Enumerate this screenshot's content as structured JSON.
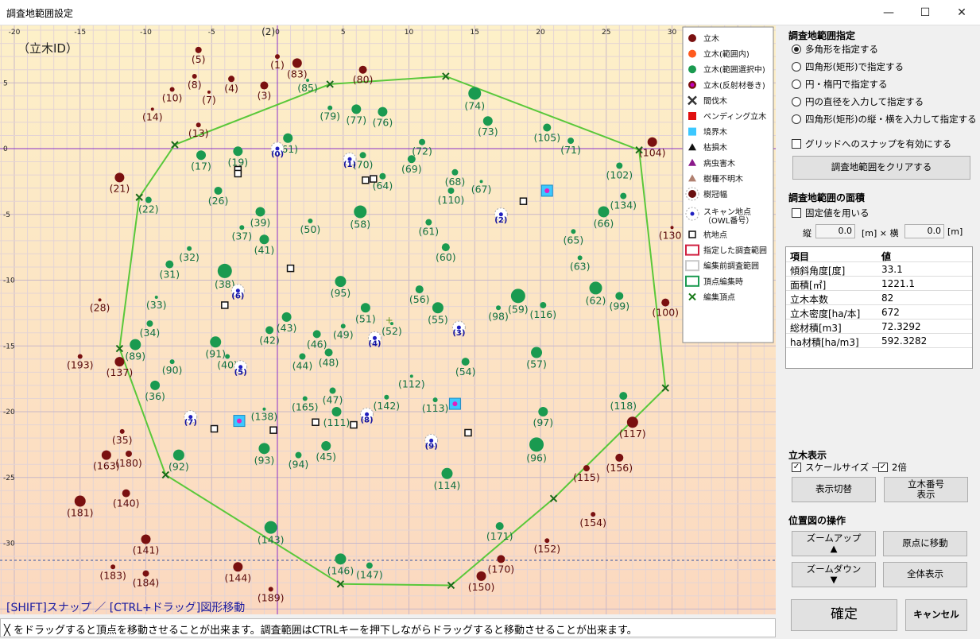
{
  "window": {
    "title": "調査地範囲設定",
    "minimize_icon": "minimize-icon",
    "maximize_icon": "maximize-icon",
    "close_icon": "close-icon"
  },
  "plot": {
    "mode_label": "（立木ID）",
    "hint": "[SHIFT]スナップ ／ [CTRL+ドラッグ]図形移動",
    "x_ticks": [
      -20,
      -15,
      -10,
      -5,
      0,
      5,
      10,
      15,
      20,
      25,
      30
    ],
    "y_ticks": [
      5,
      0,
      -5,
      -10,
      -15,
      -20,
      -25,
      -30
    ],
    "top_marker": "(2)",
    "trees": [
      {
        "id": "(5)",
        "x": -6,
        "y": 7.5,
        "r": 4,
        "c": "#7a1010"
      },
      {
        "id": "(1)",
        "x": 0,
        "y": 7,
        "r": 3,
        "c": "#7a1010"
      },
      {
        "id": "(83)",
        "x": 1.5,
        "y": 6.5,
        "r": 6,
        "c": "#7a1010"
      },
      {
        "id": "(80)",
        "x": 6.5,
        "y": 6,
        "r": 5,
        "c": "#7a1010"
      },
      {
        "id": "(8)",
        "x": -6.3,
        "y": 5.5,
        "r": 3,
        "c": "#7a1010"
      },
      {
        "id": "(4)",
        "x": -3.5,
        "y": 5.3,
        "r": 4,
        "c": "#7a1010"
      },
      {
        "id": "(3)",
        "x": -1,
        "y": 4.8,
        "r": 5,
        "c": "#7a1010"
      },
      {
        "id": "(10)",
        "x": -8,
        "y": 4.5,
        "r": 3,
        "c": "#7a1010"
      },
      {
        "id": "(7)",
        "x": -5.2,
        "y": 4.3,
        "r": 2,
        "c": "#7a1010"
      },
      {
        "id": "(85)",
        "x": 2.3,
        "y": 5.2,
        "r": 2,
        "c": "#1a9a50"
      },
      {
        "id": "(14)",
        "x": -9.5,
        "y": 3,
        "r": 2,
        "c": "#7a1010"
      },
      {
        "id": "(13)",
        "x": -6,
        "y": 1.8,
        "r": 3,
        "c": "#7a1010"
      },
      {
        "id": "(104)",
        "x": 28.5,
        "y": 0.5,
        "r": 6,
        "c": "#7a1010"
      },
      {
        "id": "(21)",
        "x": -12,
        "y": -2.2,
        "r": 6,
        "c": "#7a1010"
      },
      {
        "id": "(130)",
        "x": 30,
        "y": -6,
        "r": 2,
        "c": "#7a1010"
      },
      {
        "id": "(28)",
        "x": -13.5,
        "y": -11.5,
        "r": 2,
        "c": "#7a1010"
      },
      {
        "id": "(100)",
        "x": 29.5,
        "y": -11.7,
        "r": 5,
        "c": "#7a1010"
      },
      {
        "id": "(193)",
        "x": -15,
        "y": -15.8,
        "r": 3,
        "c": "#7a1010"
      },
      {
        "id": "(137)",
        "x": -12,
        "y": -16.2,
        "r": 6,
        "c": "#7a1010"
      },
      {
        "id": "(117)",
        "x": 27,
        "y": -20.8,
        "r": 7,
        "c": "#7a1010"
      },
      {
        "id": "(35)",
        "x": -11.8,
        "y": -21.5,
        "r": 3,
        "c": "#7a1010"
      },
      {
        "id": "(163)",
        "x": -13,
        "y": -23.3,
        "r": 6,
        "c": "#7a1010"
      },
      {
        "id": "(180)",
        "x": -11.3,
        "y": -23.2,
        "r": 4,
        "c": "#7a1010"
      },
      {
        "id": "(156)",
        "x": 26,
        "y": -23.5,
        "r": 5,
        "c": "#7a1010"
      },
      {
        "id": "(115)",
        "x": 23.5,
        "y": -24.3,
        "r": 4,
        "c": "#7a1010"
      },
      {
        "id": "(140)",
        "x": -11.5,
        "y": -26.2,
        "r": 5,
        "c": "#7a1010"
      },
      {
        "id": "(181)",
        "x": -15,
        "y": -26.8,
        "r": 7,
        "c": "#7a1010"
      },
      {
        "id": "(154)",
        "x": 24,
        "y": -27.8,
        "r": 3,
        "c": "#7a1010"
      },
      {
        "id": "(141)",
        "x": -10,
        "y": -29.7,
        "r": 6,
        "c": "#7a1010"
      },
      {
        "id": "(152)",
        "x": 20.5,
        "y": -29.8,
        "r": 3,
        "c": "#7a1010"
      },
      {
        "id": "(183)",
        "x": -12.5,
        "y": -31.8,
        "r": 3,
        "c": "#7a1010"
      },
      {
        "id": "(184)",
        "x": -10,
        "y": -32.3,
        "r": 4,
        "c": "#7a1010"
      },
      {
        "id": "(144)",
        "x": -3,
        "y": -31.8,
        "r": 6,
        "c": "#7a1010"
      },
      {
        "id": "(170)",
        "x": 17,
        "y": -31.2,
        "r": 5,
        "c": "#7a1010"
      },
      {
        "id": "(150)",
        "x": 15.5,
        "y": -32.5,
        "r": 6,
        "c": "#7a1010"
      },
      {
        "id": "(189)",
        "x": -0.5,
        "y": -33.5,
        "r": 3,
        "c": "#7a1010"
      },
      {
        "id": "(74)",
        "x": 15,
        "y": 4.2,
        "r": 8,
        "c": "#1a9a50"
      },
      {
        "id": "(79)",
        "x": 4,
        "y": 3.1,
        "r": 3,
        "c": "#1a9a50"
      },
      {
        "id": "(77)",
        "x": 6,
        "y": 3,
        "r": 6,
        "c": "#1a9a50"
      },
      {
        "id": "(76)",
        "x": 8,
        "y": 2.8,
        "r": 6,
        "c": "#1a9a50"
      },
      {
        "id": "(73)",
        "x": 16,
        "y": 2.1,
        "r": 6,
        "c": "#1a9a50"
      },
      {
        "id": "(105)",
        "x": 20.5,
        "y": 1.6,
        "r": 5,
        "c": "#1a9a50"
      },
      {
        "id": "(71)",
        "x": 22.3,
        "y": 0.6,
        "r": 4,
        "c": "#1a9a50"
      },
      {
        "id": "(61)",
        "x": 0.8,
        "y": 0.8,
        "r": 6,
        "c": "#1a9a50"
      },
      {
        "id": "(72)",
        "x": 11,
        "y": 0.5,
        "r": 4,
        "c": "#1a9a50"
      },
      {
        "id": "(19)",
        "x": -3,
        "y": -0.2,
        "r": 6,
        "c": "#1a9a50"
      },
      {
        "id": "(17)",
        "x": -5.8,
        "y": -0.5,
        "r": 6,
        "c": "#1a9a50"
      },
      {
        "id": "(70)",
        "x": 6.5,
        "y": -0.5,
        "r": 4,
        "c": "#1a9a50"
      },
      {
        "id": "(69)",
        "x": 10.2,
        "y": -0.8,
        "r": 5,
        "c": "#1a9a50"
      },
      {
        "id": "(102)",
        "x": 26,
        "y": -1.3,
        "r": 4,
        "c": "#1a9a50"
      },
      {
        "id": "(64)",
        "x": 8,
        "y": -2.1,
        "r": 4,
        "c": "#1a9a50"
      },
      {
        "id": "(68)",
        "x": 13.5,
        "y": -1.8,
        "r": 4,
        "c": "#1a9a50"
      },
      {
        "id": "(67)",
        "x": 15.5,
        "y": -2.5,
        "r": 2,
        "c": "#1a9a50"
      },
      {
        "id": "(110)",
        "x": 13.2,
        "y": -3.2,
        "r": 4,
        "c": "#1a9a50"
      },
      {
        "id": "(26)",
        "x": -4.5,
        "y": -3.2,
        "r": 5,
        "c": "#1a9a50"
      },
      {
        "id": "(22)",
        "x": -9.8,
        "y": -3.9,
        "r": 4,
        "c": "#1a9a50"
      },
      {
        "id": "(134)",
        "x": 26.3,
        "y": -3.6,
        "r": 4,
        "c": "#1a9a50"
      },
      {
        "id": "(39)",
        "x": -1.3,
        "y": -4.8,
        "r": 6,
        "c": "#1a9a50"
      },
      {
        "id": "(58)",
        "x": 6.3,
        "y": -4.8,
        "r": 8,
        "c": "#1a9a50"
      },
      {
        "id": "(66)",
        "x": 24.8,
        "y": -4.8,
        "r": 7,
        "c": "#1a9a50"
      },
      {
        "id": "(50)",
        "x": 2.5,
        "y": -5.5,
        "r": 3,
        "c": "#1a9a50"
      },
      {
        "id": "(61)",
        "x": 11.5,
        "y": -5.6,
        "r": 4,
        "c": "#1a9a50"
      },
      {
        "id": "(37)",
        "x": -2.7,
        "y": -6,
        "r": 3,
        "c": "#1a9a50"
      },
      {
        "id": "(65)",
        "x": 22.5,
        "y": -6.3,
        "r": 3,
        "c": "#1a9a50"
      },
      {
        "id": "(41)",
        "x": -1,
        "y": -6.9,
        "r": 6,
        "c": "#1a9a50"
      },
      {
        "id": "(60)",
        "x": 12.8,
        "y": -7.5,
        "r": 5,
        "c": "#1a9a50"
      },
      {
        "id": "(32)",
        "x": -6.7,
        "y": -7.6,
        "r": 3,
        "c": "#1a9a50"
      },
      {
        "id": "(63)",
        "x": 23,
        "y": -8.3,
        "r": 3,
        "c": "#1a9a50"
      },
      {
        "id": "(31)",
        "x": -8.2,
        "y": -8.8,
        "r": 5,
        "c": "#1a9a50"
      },
      {
        "id": "(38)",
        "x": -4,
        "y": -9.3,
        "r": 9,
        "c": "#1a9a50"
      },
      {
        "id": "(95)",
        "x": 4.8,
        "y": -10.1,
        "r": 7,
        "c": "#1a9a50"
      },
      {
        "id": "(56)",
        "x": 10.8,
        "y": -10.7,
        "r": 5,
        "c": "#1a9a50"
      },
      {
        "id": "(62)",
        "x": 24.2,
        "y": -10.6,
        "r": 8,
        "c": "#1a9a50"
      },
      {
        "id": "(59)",
        "x": 18.3,
        "y": -11.2,
        "r": 9,
        "c": "#1a9a50"
      },
      {
        "id": "(99)",
        "x": 26,
        "y": -11.2,
        "r": 5,
        "c": "#1a9a50"
      },
      {
        "id": "(33)",
        "x": -9.2,
        "y": -11.3,
        "r": 2,
        "c": "#1a9a50"
      },
      {
        "id": "(51)",
        "x": 6.7,
        "y": -12.1,
        "r": 6,
        "c": "#1a9a50"
      },
      {
        "id": "(55)",
        "x": 12.2,
        "y": -12.1,
        "r": 7,
        "c": "#1a9a50"
      },
      {
        "id": "(98)",
        "x": 16.8,
        "y": -12.1,
        "r": 3,
        "c": "#1a9a50"
      },
      {
        "id": "(116)",
        "x": 20.2,
        "y": -11.9,
        "r": 4,
        "c": "#1a9a50"
      },
      {
        "id": "(43)",
        "x": 0.7,
        "y": -12.8,
        "r": 6,
        "c": "#1a9a50"
      },
      {
        "id": "(34)",
        "x": -9.7,
        "y": -13.3,
        "r": 4,
        "c": "#1a9a50"
      },
      {
        "id": "(49)",
        "x": 5,
        "y": -13.5,
        "r": 3,
        "c": "#1a9a50"
      },
      {
        "id": "(52)",
        "x": 8.7,
        "y": -13.3,
        "r": 2,
        "c": "#1a9a50"
      },
      {
        "id": "(42)",
        "x": -0.6,
        "y": -13.8,
        "r": 5,
        "c": "#1a9a50"
      },
      {
        "id": "(46)",
        "x": 3,
        "y": -14.1,
        "r": 5,
        "c": "#1a9a50"
      },
      {
        "id": "(91)",
        "x": -4.7,
        "y": -14.7,
        "r": 7,
        "c": "#1a9a50"
      },
      {
        "id": "(89)",
        "x": -10.8,
        "y": -14.9,
        "r": 7,
        "c": "#1a9a50"
      },
      {
        "id": "(40)",
        "x": -3.8,
        "y": -15.8,
        "r": 3,
        "c": "#1a9a50"
      },
      {
        "id": "(48)",
        "x": 3.9,
        "y": -15.5,
        "r": 5,
        "c": "#1a9a50"
      },
      {
        "id": "(57)",
        "x": 19.7,
        "y": -15.5,
        "r": 7,
        "c": "#1a9a50"
      },
      {
        "id": "(44)",
        "x": 1.9,
        "y": -15.8,
        "r": 4,
        "c": "#1a9a50"
      },
      {
        "id": "(90)",
        "x": -8,
        "y": -16.2,
        "r": 3,
        "c": "#1a9a50"
      },
      {
        "id": "(54)",
        "x": 14.3,
        "y": -16.2,
        "r": 5,
        "c": "#1a9a50"
      },
      {
        "id": "(112)",
        "x": 10.2,
        "y": -17.3,
        "r": 2,
        "c": "#1a9a50"
      },
      {
        "id": "(36)",
        "x": -9.3,
        "y": -18,
        "r": 6,
        "c": "#1a9a50"
      },
      {
        "id": "(47)",
        "x": 4.2,
        "y": -18.4,
        "r": 4,
        "c": "#1a9a50"
      },
      {
        "id": "(118)",
        "x": 26.3,
        "y": -18.8,
        "r": 5,
        "c": "#1a9a50"
      },
      {
        "id": "(165)",
        "x": 2.1,
        "y": -19,
        "r": 3,
        "c": "#1a9a50"
      },
      {
        "id": "(142)",
        "x": 8.3,
        "y": -18.9,
        "r": 3,
        "c": "#1a9a50"
      },
      {
        "id": "(113)",
        "x": 12,
        "y": -19.1,
        "r": 3,
        "c": "#1a9a50"
      },
      {
        "id": "(138)",
        "x": -1,
        "y": -19.8,
        "r": 2,
        "c": "#1a9a50"
      },
      {
        "id": "(111)",
        "x": 4.5,
        "y": -20,
        "r": 6,
        "c": "#1a9a50"
      },
      {
        "id": "(97)",
        "x": 20.2,
        "y": -20,
        "r": 6,
        "c": "#1a9a50"
      },
      {
        "id": "(45)",
        "x": 3.7,
        "y": -22.6,
        "r": 6,
        "c": "#1a9a50"
      },
      {
        "id": "(93)",
        "x": -1,
        "y": -22.8,
        "r": 7,
        "c": "#1a9a50"
      },
      {
        "id": "(96)",
        "x": 19.7,
        "y": -22.5,
        "r": 9,
        "c": "#1a9a50"
      },
      {
        "id": "(92)",
        "x": -7.5,
        "y": -23.3,
        "r": 7,
        "c": "#1a9a50"
      },
      {
        "id": "(94)",
        "x": 1.6,
        "y": -23.3,
        "r": 4,
        "c": "#1a9a50"
      },
      {
        "id": "(114)",
        "x": 12.9,
        "y": -24.7,
        "r": 7,
        "c": "#1a9a50"
      },
      {
        "id": "(171)",
        "x": 16.9,
        "y": -28.7,
        "r": 5,
        "c": "#1a9a50"
      },
      {
        "id": "(143)",
        "x": -0.5,
        "y": -28.8,
        "r": 8,
        "c": "#1a9a50"
      },
      {
        "id": "(146)",
        "x": 4.8,
        "y": -31.2,
        "r": 7,
        "c": "#1a9a50"
      },
      {
        "id": "(147)",
        "x": 7,
        "y": -31.7,
        "r": 4,
        "c": "#1a9a50"
      }
    ],
    "scan_points": [
      {
        "id": "(0)",
        "x": 0,
        "y": 0
      },
      {
        "id": "(1)",
        "x": 5.5,
        "y": -0.8
      },
      {
        "id": "(2)",
        "x": 17,
        "y": -5
      },
      {
        "id": "(6)",
        "x": -3,
        "y": -10.8
      },
      {
        "id": "(4)",
        "x": 7.4,
        "y": -14.4
      },
      {
        "id": "(3)",
        "x": 13.8,
        "y": -13.6
      },
      {
        "id": "(5)",
        "x": -2.8,
        "y": -16.6
      },
      {
        "id": "(8)",
        "x": 6.8,
        "y": -20.2
      },
      {
        "id": "(7)",
        "x": -6.6,
        "y": -20.4
      },
      {
        "id": "(9)",
        "x": 11.7,
        "y": -22.2
      }
    ],
    "stakes": [
      [
        -3,
        -1.6
      ],
      [
        -3,
        -1.9
      ],
      [
        6.7,
        -2.4
      ],
      [
        7.3,
        -2.3
      ],
      [
        18.7,
        -4
      ],
      [
        1,
        -9.1
      ],
      [
        -4,
        -11.9
      ],
      [
        -4.8,
        -21.3
      ],
      [
        -0.3,
        -21.4
      ],
      [
        2.9,
        -20.8
      ],
      [
        5.8,
        -21
      ],
      [
        14.5,
        -21.6
      ]
    ],
    "boundary_trees": [
      {
        "x": 20.5,
        "y": -3.2
      },
      {
        "x": -2.9,
        "y": -20.7
      },
      {
        "x": 13.5,
        "y": -19.4
      }
    ],
    "polygon": [
      [
        4,
        4.9
      ],
      [
        12.8,
        5.5
      ],
      [
        27.5,
        -0.1
      ],
      [
        29.5,
        -18.2
      ],
      [
        21,
        -26.6
      ],
      [
        13.2,
        -33.2
      ],
      [
        4.8,
        -33.1
      ],
      [
        -8.5,
        -24.8
      ],
      [
        -12,
        -15.2
      ],
      [
        -10.5,
        -3.7
      ],
      [
        -7.8,
        0.3
      ]
    ],
    "legend": [
      {
        "type": "tree",
        "label": "立木",
        "color": "#7a1010"
      },
      {
        "type": "tree",
        "label": "立木(範囲内)",
        "color": "#ff5a1e"
      },
      {
        "type": "tree",
        "label": "立木(範囲選択中)",
        "color": "#1a9a50"
      },
      {
        "type": "reflect",
        "label": "立木(反射材巻き)",
        "color": "#c000c0"
      },
      {
        "type": "cross",
        "label": "間伐木",
        "color": "#333"
      },
      {
        "type": "square",
        "label": "ペンディング立木",
        "color": "#e01010"
      },
      {
        "type": "square",
        "label": "境界木",
        "color": "#3cc8ff"
      },
      {
        "type": "tri",
        "label": "枯損木",
        "color": "#111"
      },
      {
        "type": "tri",
        "label": "病虫害木",
        "color": "#8a1a8a"
      },
      {
        "type": "tri",
        "label": "樹種不明木",
        "color": "#b08070"
      },
      {
        "type": "crown",
        "label": "樹冠幅",
        "color": "#6a1010"
      },
      {
        "type": "scan",
        "label": "スキャン地点\n（OWL番号）",
        "color": "#2020c0"
      },
      {
        "type": "stake",
        "label": "杭地点",
        "color": "#111"
      },
      {
        "type": "rect",
        "label": "指定した調査範囲",
        "color": "#d02040"
      },
      {
        "type": "rect",
        "label": "編集前調査範囲",
        "color": "#c8c8c8"
      },
      {
        "type": "rect",
        "label": "頂点編集時",
        "color": "#1a9a50"
      },
      {
        "type": "vx",
        "label": "編集頂点",
        "color": "#1a7a1a"
      }
    ]
  },
  "status": "╳ をドラッグすると頂点を移動させることが出来ます。調査範囲はCTRLキーを押下しながらドラッグすると移動させることが出来ます。",
  "area_spec": {
    "title": "調査地範囲指定",
    "options": [
      "多角形を指定する",
      "四角形(矩形)で指定する",
      "円・楕円で指定する",
      "円の直径を入力して指定する",
      "四角形(矩形)の縦・横を入力して指定する"
    ],
    "selected": 0,
    "grid_snap": "グリッドへのスナップを有効にする",
    "clear_button": "調査地範囲をクリアする"
  },
  "area_size": {
    "title": "調査地範囲の面積",
    "fixed_label": "固定値を用いる",
    "vert_label": "縦",
    "vert_value": "0.0",
    "unit1": "[m] × 横",
    "horiz_value": "0.0",
    "unit2": "[m]"
  },
  "stats": {
    "header": [
      "項目",
      "値"
    ],
    "rows": [
      [
        "傾斜角度[度]",
        "33.1"
      ],
      [
        "面積[㎡]",
        "1221.1"
      ],
      [
        "立木本数",
        "82"
      ],
      [
        "立木密度[ha/本]",
        "672"
      ],
      [
        "総材積[m3]",
        "72.3292"
      ],
      [
        "ha材積[ha/m3]",
        "592.3282"
      ]
    ]
  },
  "tree_display": {
    "title": "立木表示",
    "scale_label": "スケールサイズ —",
    "double_label": "2倍",
    "toggle_button": "表示切替",
    "number_button": "立木番号\n表示"
  },
  "map_ops": {
    "title": "位置図の操作",
    "zoom_in": "ズームアップ",
    "zoom_out": "ズームダウン",
    "origin": "原点に移動",
    "all": "全体表示"
  },
  "footer": {
    "ok": "確定",
    "cancel": "キャンセル"
  }
}
